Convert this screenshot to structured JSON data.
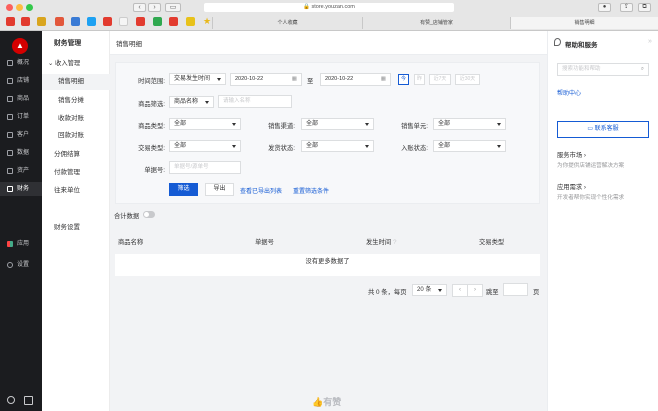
{
  "browser": {
    "url": "store.youzan.com",
    "tabs": [
      "个人收藏",
      "有赞_店铺管家",
      "销售明细"
    ]
  },
  "leftnav": {
    "items": [
      {
        "label": "概况"
      },
      {
        "label": "店铺"
      },
      {
        "label": "商品"
      },
      {
        "label": "订单"
      },
      {
        "label": "客户"
      },
      {
        "label": "数据"
      },
      {
        "label": "资产"
      },
      {
        "label": "财务"
      }
    ],
    "bottom": [
      {
        "label": "应用"
      },
      {
        "label": "设置"
      }
    ]
  },
  "subnav": {
    "title": "财务管理",
    "group": "收入管理",
    "group_items": [
      "销售明细",
      "销售分摊",
      "收款对账",
      "回款对账"
    ],
    "items": [
      "分佣结算",
      "付款管理",
      "往来单位"
    ],
    "settings": "财务设置"
  },
  "header": {
    "title": "销售明细"
  },
  "filter": {
    "time_label": "时间范围:",
    "time_type": "交易发生时间",
    "date_start": "2020-10-22",
    "date_sep": "至",
    "date_end": "2020-10-22",
    "quick": [
      "今",
      "昨",
      "近7天",
      "近30天"
    ],
    "goods_label": "商品筛选:",
    "goods_type": "商品名称",
    "goods_placeholder": "请输入名称",
    "goods_kind_label": "商品类型:",
    "goods_kind": "全部",
    "channel_label": "销售渠道:",
    "channel": "全部",
    "unit_label": "销售单元:",
    "unit": "全部",
    "trade_label": "交易类型:",
    "trade": "全部",
    "ship_label": "发货状态:",
    "ship": "全部",
    "account_label": "入账状态:",
    "account": "全部",
    "doc_label": "单据号:",
    "doc_placeholder": "单据号/源单号",
    "btn_filter": "筛选",
    "btn_export": "导出",
    "link_exported": "查看已导出列表",
    "link_reset": "重置筛选条件"
  },
  "table": {
    "toggle_label": "合计数据",
    "columns": [
      "商品名称",
      "单据号",
      "发生时间",
      "交易类型"
    ],
    "empty": "没有更多数据了"
  },
  "pagination": {
    "summary": "共 0 条，每页",
    "page_size": "20 条",
    "jump_label": "跳至",
    "page_unit": "页"
  },
  "right": {
    "title": "帮助和服务",
    "search_placeholder": "搜索功能和帮助",
    "help_center": "帮助中心",
    "contact": "联系客服",
    "market_title": "服务市场 ›",
    "market_desc": "为你提供店铺运营解决方案",
    "req_title": "应用需求 ›",
    "req_desc": "开发者帮你实现个性化需求"
  },
  "footer": {
    "brand": "有赞"
  },
  "colors": {
    "accent": "#155bd4",
    "sidebar": "#1b1c1f",
    "brand_red": "#d40000"
  }
}
